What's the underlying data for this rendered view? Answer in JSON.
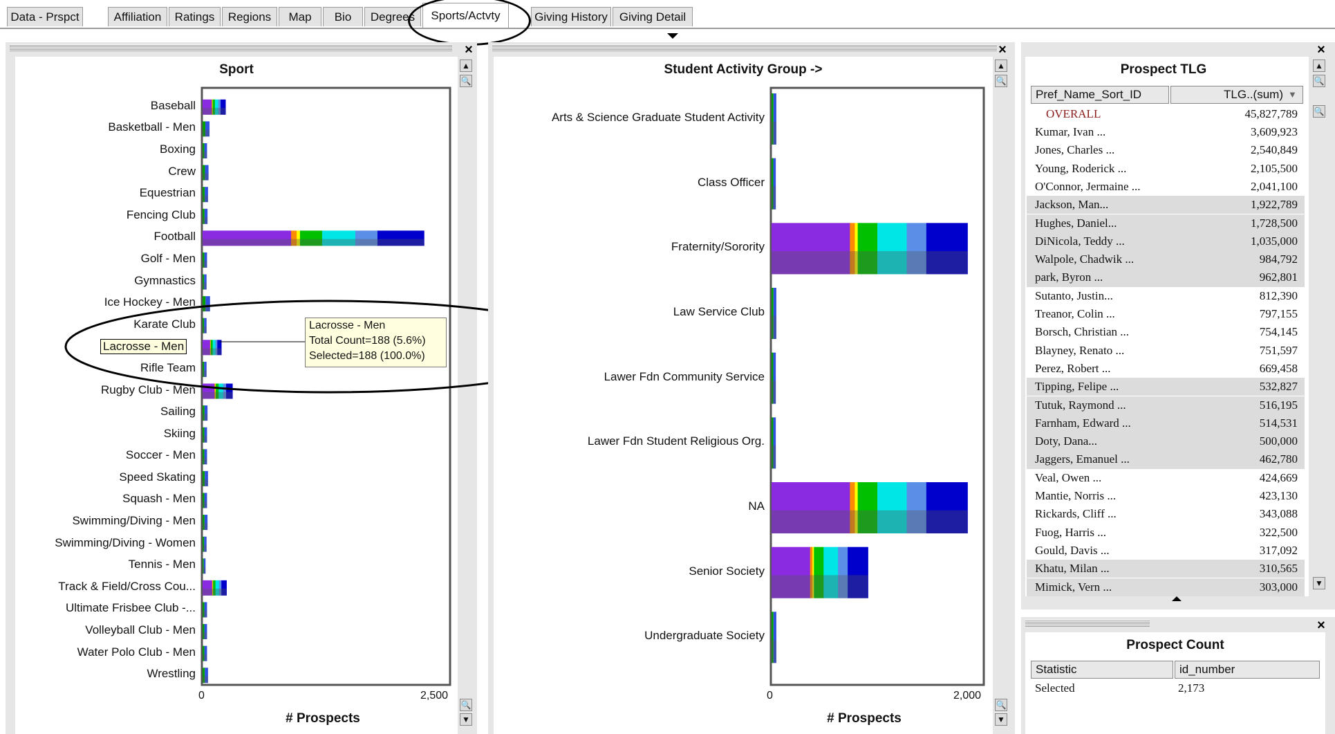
{
  "tabs": [
    {
      "label": "Data - Prspct",
      "left": 10,
      "width": 110
    },
    {
      "label": "Affiliation",
      "left": 156,
      "width": 86
    },
    {
      "label": "Ratings",
      "left": 244,
      "width": 75
    },
    {
      "label": "Regions",
      "left": 321,
      "width": 80
    },
    {
      "label": "Map",
      "left": 403,
      "width": 62
    },
    {
      "label": "Bio",
      "left": 467,
      "width": 58
    },
    {
      "label": "Degrees",
      "left": 527,
      "width": 82
    },
    {
      "label": "Sports/Actvty",
      "left": 611,
      "width": 125
    },
    {
      "label": "Giving History",
      "left": 768,
      "width": 116
    },
    {
      "label": "Giving Detail",
      "left": 886,
      "width": 116
    }
  ],
  "active_tab": "Sports/Actvty",
  "sport_panel": {
    "title": "Sport",
    "axis_title": "# Prospects",
    "x_ticks": [
      "0",
      "2,500"
    ],
    "tooltip": {
      "line1": "Lacrosse - Men",
      "line2": "Total Count=188 (5.6%)",
      "line3": "Selected=188 (100.0%)"
    }
  },
  "activity_panel": {
    "title": "Student Activity Group ->",
    "axis_title": "# Prospects",
    "x_ticks": [
      "0",
      "2,000"
    ]
  },
  "tlg_panel": {
    "title": "Prospect TLG",
    "col1": "Pref_Name_Sort_ID",
    "col2": "TLG..(sum)",
    "overall_label": "OVERALL",
    "overall_value": "45,827,789",
    "rows": [
      {
        "name": "Kumar, Ivan ...",
        "value": "3,609,923",
        "shade": false
      },
      {
        "name": "Jones, Charles ...",
        "value": "2,540,849",
        "shade": false
      },
      {
        "name": "Young, Roderick ...",
        "value": "2,105,500",
        "shade": false
      },
      {
        "name": "O'Connor, Jermaine ...",
        "value": "2,041,100",
        "shade": false
      },
      {
        "name": "Jackson, Man...",
        "value": "1,922,789",
        "shade": true
      },
      {
        "name": "Hughes, Daniel...",
        "value": "1,728,500",
        "shade": true
      },
      {
        "name": "DiNicola, Teddy ...",
        "value": "1,035,000",
        "shade": true
      },
      {
        "name": "Walpole, Chadwik ...",
        "value": "984,792",
        "shade": true
      },
      {
        "name": "park, Byron ...",
        "value": "962,801",
        "shade": true
      },
      {
        "name": "Sutanto, Justin...",
        "value": "812,390",
        "shade": false
      },
      {
        "name": "Treanor, Colin ...",
        "value": "797,155",
        "shade": false
      },
      {
        "name": "Borsch, Christian ...",
        "value": "754,145",
        "shade": false
      },
      {
        "name": "Blayney, Renato ...",
        "value": "751,597",
        "shade": false
      },
      {
        "name": "Perez, Robert ...",
        "value": "669,458",
        "shade": false
      },
      {
        "name": "Tipping, Felipe ...",
        "value": "532,827",
        "shade": true
      },
      {
        "name": "Tutuk, Raymond ...",
        "value": "516,195",
        "shade": true
      },
      {
        "name": "Farnham, Edward ...",
        "value": "514,531",
        "shade": true
      },
      {
        "name": "Doty, Dana...",
        "value": "500,000",
        "shade": true
      },
      {
        "name": "Jaggers, Emanuel ...",
        "value": "462,780",
        "shade": true
      },
      {
        "name": "Veal, Owen ...",
        "value": "424,669",
        "shade": false
      },
      {
        "name": "Mantie, Norris ...",
        "value": "423,130",
        "shade": false
      },
      {
        "name": "Rickards, Cliff ...",
        "value": "343,088",
        "shade": false
      },
      {
        "name": "Fuog, Harris ...",
        "value": "322,500",
        "shade": false
      },
      {
        "name": "Gould, Davis ...",
        "value": "317,092",
        "shade": false
      },
      {
        "name": "Khatu, Milan ...",
        "value": "310,565",
        "shade": true
      },
      {
        "name": "Mimick, Vern ...",
        "value": "303,000",
        "shade": true
      }
    ]
  },
  "count_panel": {
    "title": "Prospect Count",
    "col1": "Statistic",
    "col2": "id_number",
    "row_label": "Selected",
    "row_value": "2,173"
  },
  "chart_data": [
    {
      "type": "bar",
      "title": "Sport",
      "xlabel": "# Prospects",
      "xlim": [
        0,
        2500
      ],
      "categories": [
        "Baseball",
        "Basketball - Men",
        "Boxing",
        "Crew",
        "Equestrian",
        "Fencing Club",
        "Football",
        "Golf - Men",
        "Gymnastics",
        "Ice Hockey - Men",
        "Karate Club",
        "Lacrosse - Men",
        "Rifle Team",
        "Rugby Club - Men",
        "Sailing",
        "Skiing",
        "Soccer - Men",
        "Speed Skating",
        "Squash - Men",
        "Swimming/Diving - Men",
        "Swimming/Diving - Women",
        "Tennis - Men",
        "Track & Field/Cross Cou...",
        "Ultimate Frisbee Club -...",
        "Volleyball Club - Men",
        "Water Polo Club - Men",
        "Wrestling"
      ],
      "values": [
        230,
        70,
        45,
        60,
        55,
        50,
        2230,
        45,
        40,
        75,
        40,
        188,
        40,
        300,
        50,
        45,
        45,
        55,
        45,
        50,
        40,
        30,
        240,
        45,
        45,
        45,
        55
      ]
    },
    {
      "type": "bar",
      "title": "Student Activity Group ->",
      "xlabel": "# Prospects",
      "xlim": [
        0,
        2000
      ],
      "categories": [
        "Arts & Science Graduate Student Activity",
        "Class Officer",
        "Fraternity/Sorority",
        "Law Service Club",
        "Lawer Fdn Community Service",
        "Lawer Fdn Student Religious Org.",
        "NA",
        "Senior Society",
        "Undergraduate Society"
      ],
      "values": [
        45,
        40,
        1840,
        45,
        40,
        40,
        1840,
        905,
        45
      ]
    }
  ]
}
